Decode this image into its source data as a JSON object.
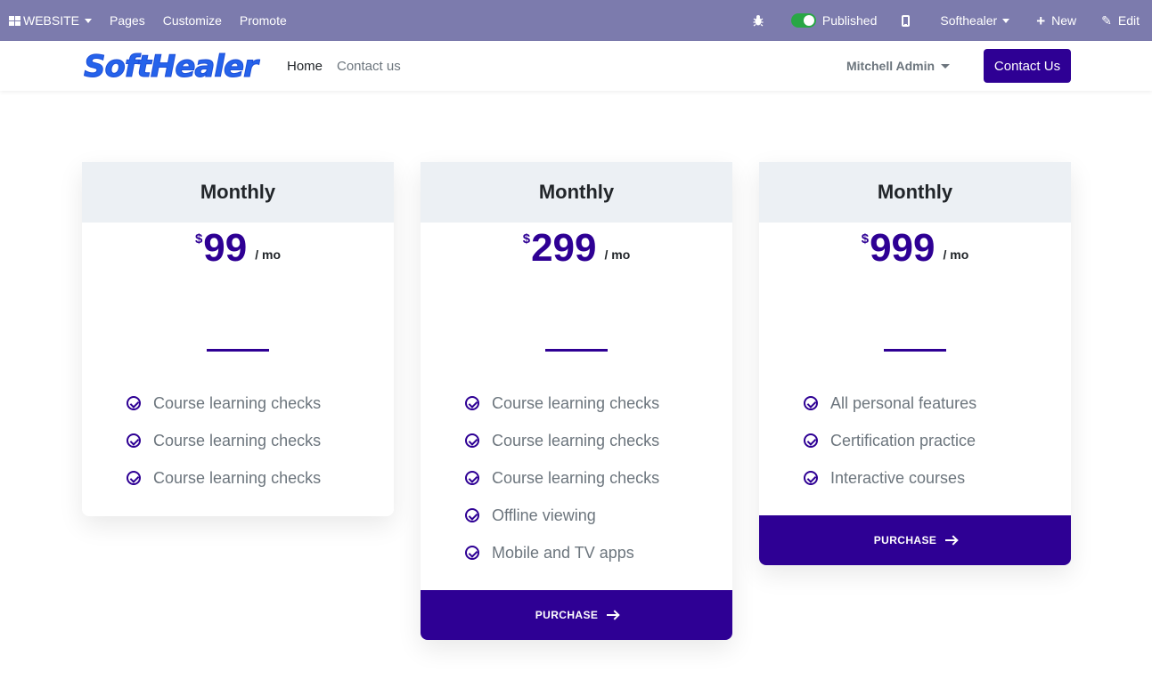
{
  "admin_bar": {
    "website": "WEBSITE",
    "pages": "Pages",
    "customize": "Customize",
    "promote": "Promote",
    "published": "Published",
    "company": "Softhealer",
    "new": "New",
    "edit": "Edit"
  },
  "navbar": {
    "logo": "SoftHealer",
    "home": "Home",
    "contact_link": "Contact us",
    "user": "Mitchell Admin",
    "contact_button": "Contact Us"
  },
  "plans": [
    {
      "title": "Monthly",
      "currency": "$",
      "price": "99",
      "period": "/ mo",
      "features": [
        "Course learning checks",
        "Course learning checks",
        "Course learning checks"
      ],
      "button": null
    },
    {
      "title": "Monthly",
      "currency": "$",
      "price": "299",
      "period": "/ mo",
      "features": [
        "Course learning checks",
        "Course learning checks",
        "Course learning checks",
        "Offline viewing",
        "Mobile and TV apps"
      ],
      "button": "PURCHASE"
    },
    {
      "title": "Monthly",
      "currency": "$",
      "price": "999",
      "period": "/ mo",
      "features": [
        "All personal features",
        "Certification practice",
        "Interactive courses"
      ],
      "button": "PURCHASE"
    }
  ],
  "colors": {
    "admin_bar": "#7c7bad",
    "accent": "#2e0094",
    "card_header": "#ecf0f4"
  }
}
